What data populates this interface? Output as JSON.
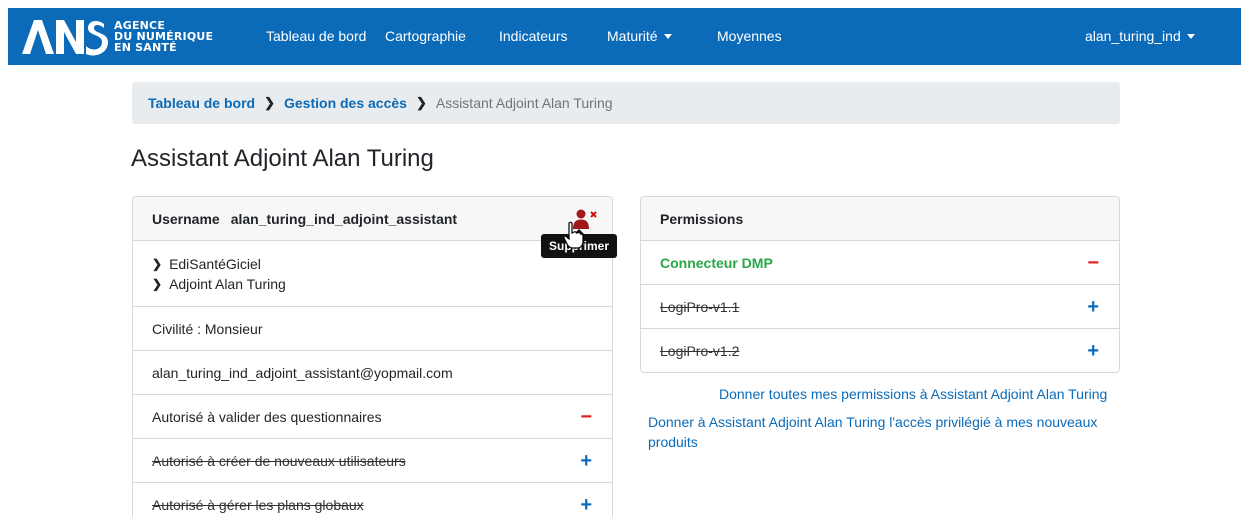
{
  "navbar": {
    "logo_lines": [
      "AGENCE",
      "DU NUMÉRIQUE",
      "EN SANTÉ"
    ],
    "items": [
      "Tableau de bord",
      "Cartographie",
      "Indicateurs",
      "Maturité",
      "Moyennes"
    ],
    "user": "alan_turing_ind",
    "background": "#0b6bb8"
  },
  "breadcrumb": {
    "items": [
      "Tableau de bord",
      "Gestion des accès"
    ],
    "current": "Assistant Adjoint Alan Turing"
  },
  "page_title": "Assistant Adjoint Alan Turing",
  "user_card": {
    "username_label": "Username",
    "username": "alan_turing_ind_adjoint_assistant",
    "delete_tooltip": "Supprimer",
    "organizations": [
      "EdiSantéGiciel",
      "Adjoint Alan Turing"
    ],
    "civility": "Civilité : Monsieur",
    "email": "alan_turing_ind_adjoint_assistant@yopmail.com",
    "rights": [
      {
        "label": "Autorisé à valider des questionnaires",
        "granted": true,
        "action": "−"
      },
      {
        "label": "Autorisé à créer de nouveaux utilisateurs",
        "granted": false,
        "action": "+"
      },
      {
        "label": "Autorisé à gérer les plans globaux",
        "granted": false,
        "action": "+"
      }
    ]
  },
  "permissions_card": {
    "title": "Permissions",
    "items": [
      {
        "label": "Connecteur DMP",
        "granted": true,
        "action": "−"
      },
      {
        "label": "LogiPro-v1.1",
        "granted": false,
        "action": "+"
      },
      {
        "label": "LogiPro-v1.2",
        "granted": false,
        "action": "+"
      }
    ],
    "give_all_link": "Donner toutes mes permissions à Assistant Adjoint Alan Turing",
    "give_privileged_link": "Donner à Assistant Adjoint Alan Turing l'accès privilégié à mes nouveaux produits"
  },
  "colors": {
    "accent": "#0b6bb8",
    "danger": "#e02020",
    "success": "#28a745"
  }
}
